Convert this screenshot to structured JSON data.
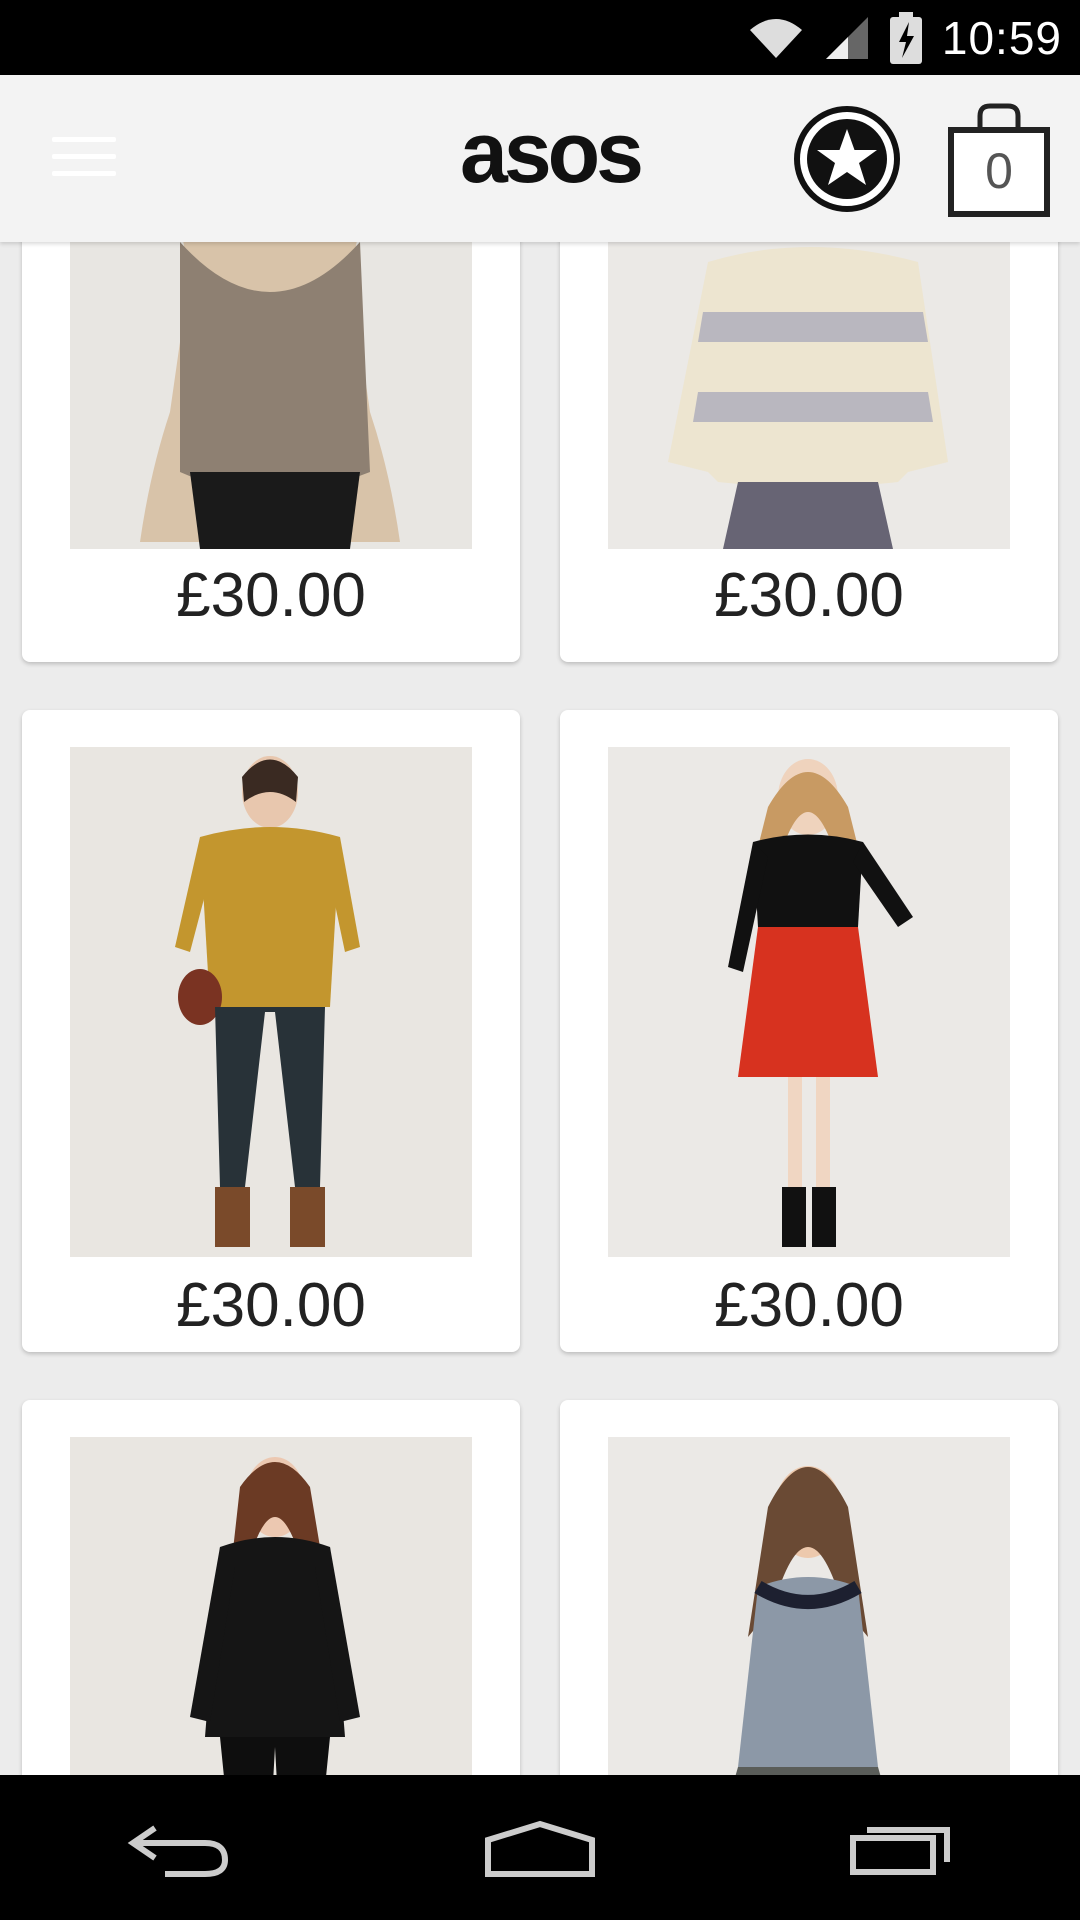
{
  "status_bar": {
    "time": "10:59"
  },
  "app_bar": {
    "logo": "asos",
    "bag_count": "0"
  },
  "products": [
    {
      "price": "£30.00",
      "desc": "metallic top"
    },
    {
      "price": "£30.00",
      "desc": "striped knit"
    },
    {
      "price": "£30.00",
      "desc": "mustard knit"
    },
    {
      "price": "£30.00",
      "desc": "red skirt"
    },
    {
      "price": "",
      "desc": "leather jacket"
    },
    {
      "price": "",
      "desc": "lace top"
    }
  ],
  "colors": {
    "status_bar": "#000000",
    "app_bar": "#f3f3f3",
    "card": "#ffffff",
    "price": "#222222"
  }
}
